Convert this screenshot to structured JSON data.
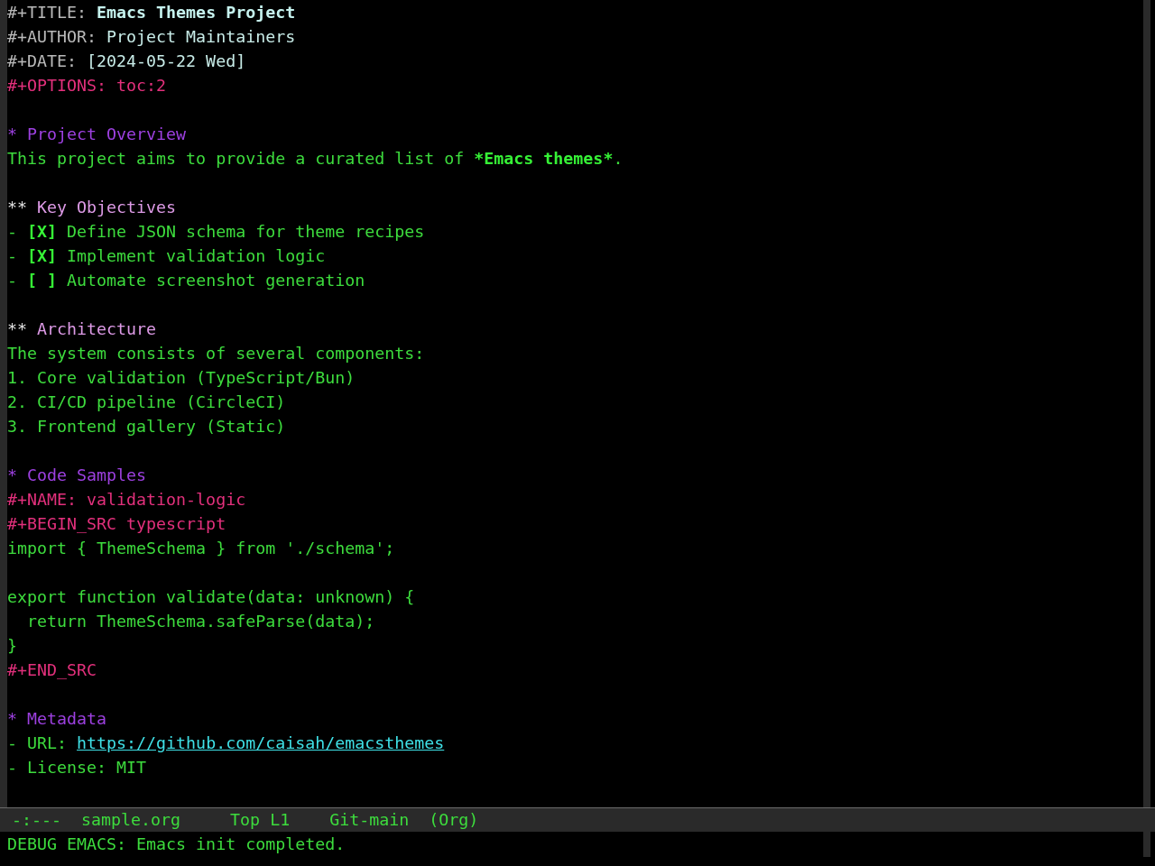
{
  "buffer": {
    "lines": [
      {
        "kind": "title",
        "keyword": "#+TITLE:",
        "value": "Emacs Themes Project"
      },
      {
        "kind": "meta",
        "keyword": "#+AUTHOR:",
        "value": "Project Maintainers"
      },
      {
        "kind": "meta",
        "keyword": "#+DATE:",
        "value": "[2024-05-22 Wed]"
      },
      {
        "kind": "directive",
        "text": "#+OPTIONS: toc:2"
      },
      {
        "kind": "blank"
      },
      {
        "kind": "heading1",
        "marker": "*",
        "text": "Project Overview"
      },
      {
        "kind": "paragraph",
        "parts": [
          {
            "text": "This project aims to provide a curated list of ",
            "bold": false
          },
          {
            "text": "*Emacs themes*",
            "bold": true
          },
          {
            "text": ".",
            "bold": false
          }
        ]
      },
      {
        "kind": "blank"
      },
      {
        "kind": "heading2",
        "marker": "**",
        "text": "Key Objectives"
      },
      {
        "kind": "checkbox",
        "bullet": "-",
        "box": "[X]",
        "text": "Define JSON schema for theme recipes"
      },
      {
        "kind": "checkbox",
        "bullet": "-",
        "box": "[X]",
        "text": "Implement validation logic"
      },
      {
        "kind": "checkbox",
        "bullet": "-",
        "box": "[ ]",
        "text": "Automate screenshot generation"
      },
      {
        "kind": "blank"
      },
      {
        "kind": "heading2",
        "marker": "**",
        "text": "Architecture"
      },
      {
        "kind": "text",
        "text": "The system consists of several components:"
      },
      {
        "kind": "text",
        "text": "1. Core validation (TypeScript/Bun)"
      },
      {
        "kind": "text",
        "text": "2. CI/CD pipeline (CircleCI)"
      },
      {
        "kind": "text",
        "text": "3. Frontend gallery (Static)"
      },
      {
        "kind": "blank"
      },
      {
        "kind": "heading1",
        "marker": "*",
        "text": "Code Samples"
      },
      {
        "kind": "directive",
        "text": "#+NAME: validation-logic"
      },
      {
        "kind": "directive",
        "text": "#+BEGIN_SRC typescript"
      },
      {
        "kind": "code",
        "text": "import { ThemeSchema } from './schema';"
      },
      {
        "kind": "blank"
      },
      {
        "kind": "code",
        "text": "export function validate(data: unknown) {"
      },
      {
        "kind": "code",
        "text": "  return ThemeSchema.safeParse(data);"
      },
      {
        "kind": "code",
        "text": "}"
      },
      {
        "kind": "directive",
        "text": "#+END_SRC"
      },
      {
        "kind": "blank"
      },
      {
        "kind": "heading1",
        "marker": "*",
        "text": "Metadata"
      },
      {
        "kind": "link",
        "label": "- URL:",
        "url": "https://github.com/caisah/emacsthemes"
      },
      {
        "kind": "text",
        "text": "- License: MIT"
      }
    ]
  },
  "mode_line": {
    "status": "-:---",
    "buffer_name": "sample.org",
    "position": "Top L1",
    "branch": "Git-main",
    "mode": "(Org)"
  },
  "echo_area": {
    "message": "DEBUG EMACS: Emacs init completed."
  }
}
